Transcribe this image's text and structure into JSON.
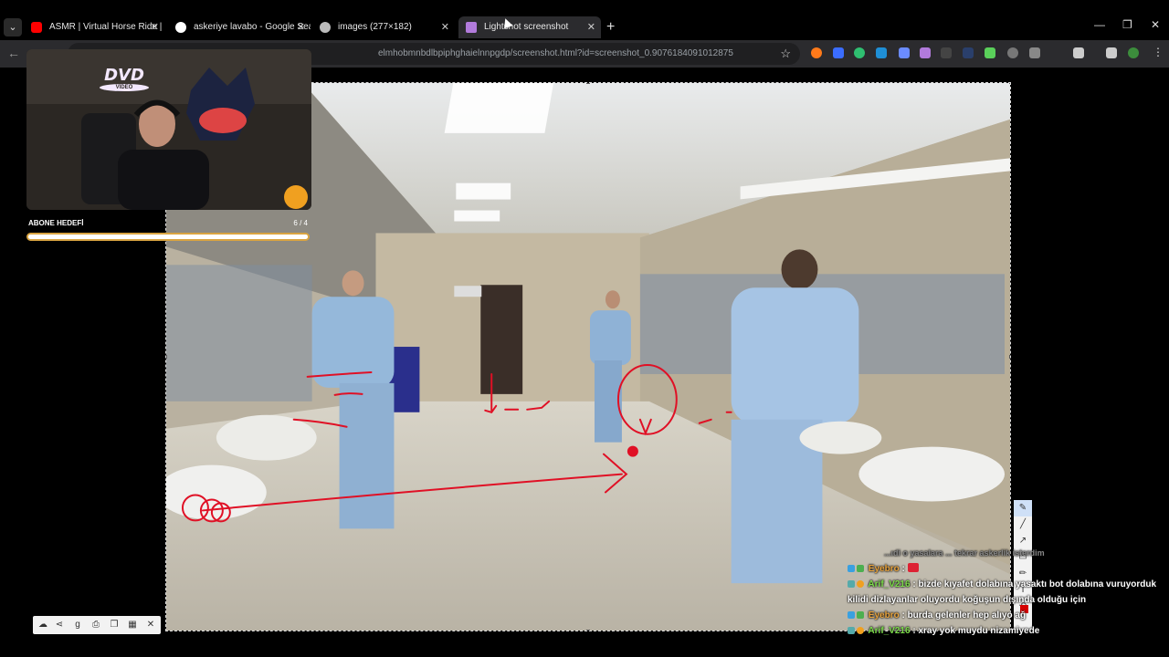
{
  "browser": {
    "tabs": [
      {
        "title": "ASMR | Virtual Horse Ride | Maj",
        "favicon": "youtube-icon",
        "active": false
      },
      {
        "title": "askeriye lavabo - Google Search",
        "favicon": "google-icon",
        "active": false
      },
      {
        "title": "images (277×182)",
        "favicon": "globe-icon",
        "active": false
      },
      {
        "title": "Lightshot screenshot",
        "favicon": "lightshot-feather-icon",
        "active": true
      }
    ],
    "new_tab": "+",
    "close_glyph": "✕",
    "address": "elmhobmnbdlbpiphghaielnnpgdp/screenshot.html?id=screenshot_0.9076184091012875",
    "window_controls": [
      "—",
      "❐",
      "✕"
    ]
  },
  "stream_overlay": {
    "dvd_logo": "DVD",
    "dvd_sub": "VIDEO",
    "sub_goal_label": "ABONE HEDEFİ",
    "sub_goal_count": "6 / 4",
    "sub_goal_progress": 1.0
  },
  "chat": [
    {
      "user": "",
      "text": "...ıdi o yasalara ... tekrar askerlik isterdim",
      "faded": true,
      "color": "#888888"
    },
    {
      "user": "Eyebro",
      "text": ":",
      "color": "#e8a33d",
      "emote": true
    },
    {
      "user": "Arif_V216",
      "text": ": bizde kıyafet dolabına yasaktı bot dolabına vuruyorduk kilidi dizlayanlar oluyordu koğuşun dışında olduğu için",
      "color": "#7ddc4b"
    },
    {
      "user": "Eyebro",
      "text": ": burda gelenler hep alıyo ağ",
      "color": "#e8a33d"
    },
    {
      "user": "Arif_V216",
      "text": ": xray yok muydu nizamiyede",
      "color": "#7ddc4b"
    }
  ],
  "colors": {
    "annotation": "#e01025",
    "toolbar_bg": "#2b2b2e",
    "accent_goal": "#d9a441"
  }
}
